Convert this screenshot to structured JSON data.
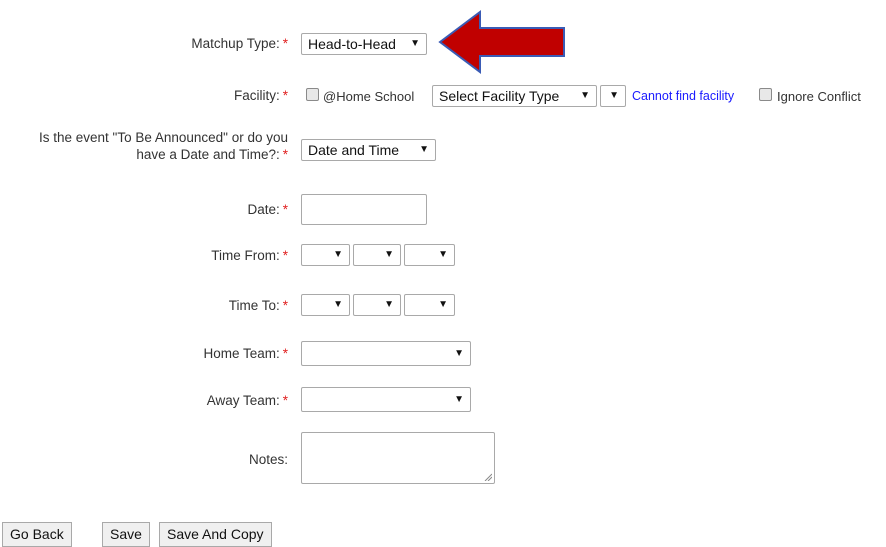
{
  "required_marker": "*",
  "form": {
    "matchup_type": {
      "label": "Matchup Type:",
      "value": "Head-to-Head"
    },
    "facility": {
      "label": "Facility:",
      "home_school_label": "@Home School",
      "facility_type_value": "Select Facility Type",
      "facility_value": "",
      "cannot_find_link": "Cannot find facility",
      "ignore_conflict_label": "Ignore Conflict"
    },
    "tba": {
      "label_line1": "Is the event \"To Be Announced\" or do you",
      "label_line2": "have a Date and Time?:",
      "value": "Date and Time"
    },
    "date": {
      "label": "Date:",
      "value": ""
    },
    "time_from": {
      "label": "Time From:",
      "hour": "",
      "minute": "",
      "ampm": ""
    },
    "time_to": {
      "label": "Time To:",
      "hour": "",
      "minute": "",
      "ampm": ""
    },
    "home_team": {
      "label": "Home Team:",
      "value": ""
    },
    "away_team": {
      "label": "Away Team:",
      "value": ""
    },
    "notes": {
      "label": "Notes:",
      "value": ""
    }
  },
  "buttons": {
    "go_back": "Go Back",
    "save": "Save",
    "save_and_copy": "Save And Copy"
  },
  "dropdown_arrow": "▼",
  "colors": {
    "required": "#e02020",
    "link": "#1a1aff",
    "annotation_arrow_fill": "#c00000",
    "annotation_arrow_outline": "#3a5bb5"
  }
}
